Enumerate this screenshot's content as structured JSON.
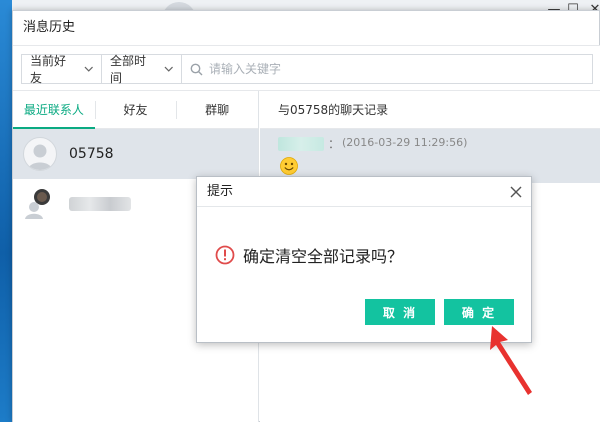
{
  "window": {
    "title": "消息历史"
  },
  "filters": {
    "contact_scope": "当前好友",
    "time_range": "全部时间",
    "search_placeholder": "请输入关键字"
  },
  "tabs": [
    {
      "label": "最近联系人",
      "active": true
    },
    {
      "label": "好友",
      "active": false
    },
    {
      "label": "群聊",
      "active": false
    }
  ],
  "contacts": [
    {
      "name": "05758",
      "selected": true,
      "avatar": "default-avatar-icon"
    },
    {
      "name": "",
      "selected": false,
      "avatar": "user-photo"
    }
  ],
  "chat": {
    "title": "与05758的聊天记录",
    "messages": [
      {
        "sender_separator": "：",
        "time": "(2016-03-29 11:29:56)",
        "content_icon": "smiley-emoji"
      }
    ]
  },
  "dialog": {
    "title": "提示",
    "message": "确定清空全部记录吗？",
    "cancel_label": "取 消",
    "ok_label": "确 定"
  },
  "colors": {
    "accent": "#13c3a0",
    "arrow": "#e8322f",
    "warning": "#e04b4b"
  }
}
